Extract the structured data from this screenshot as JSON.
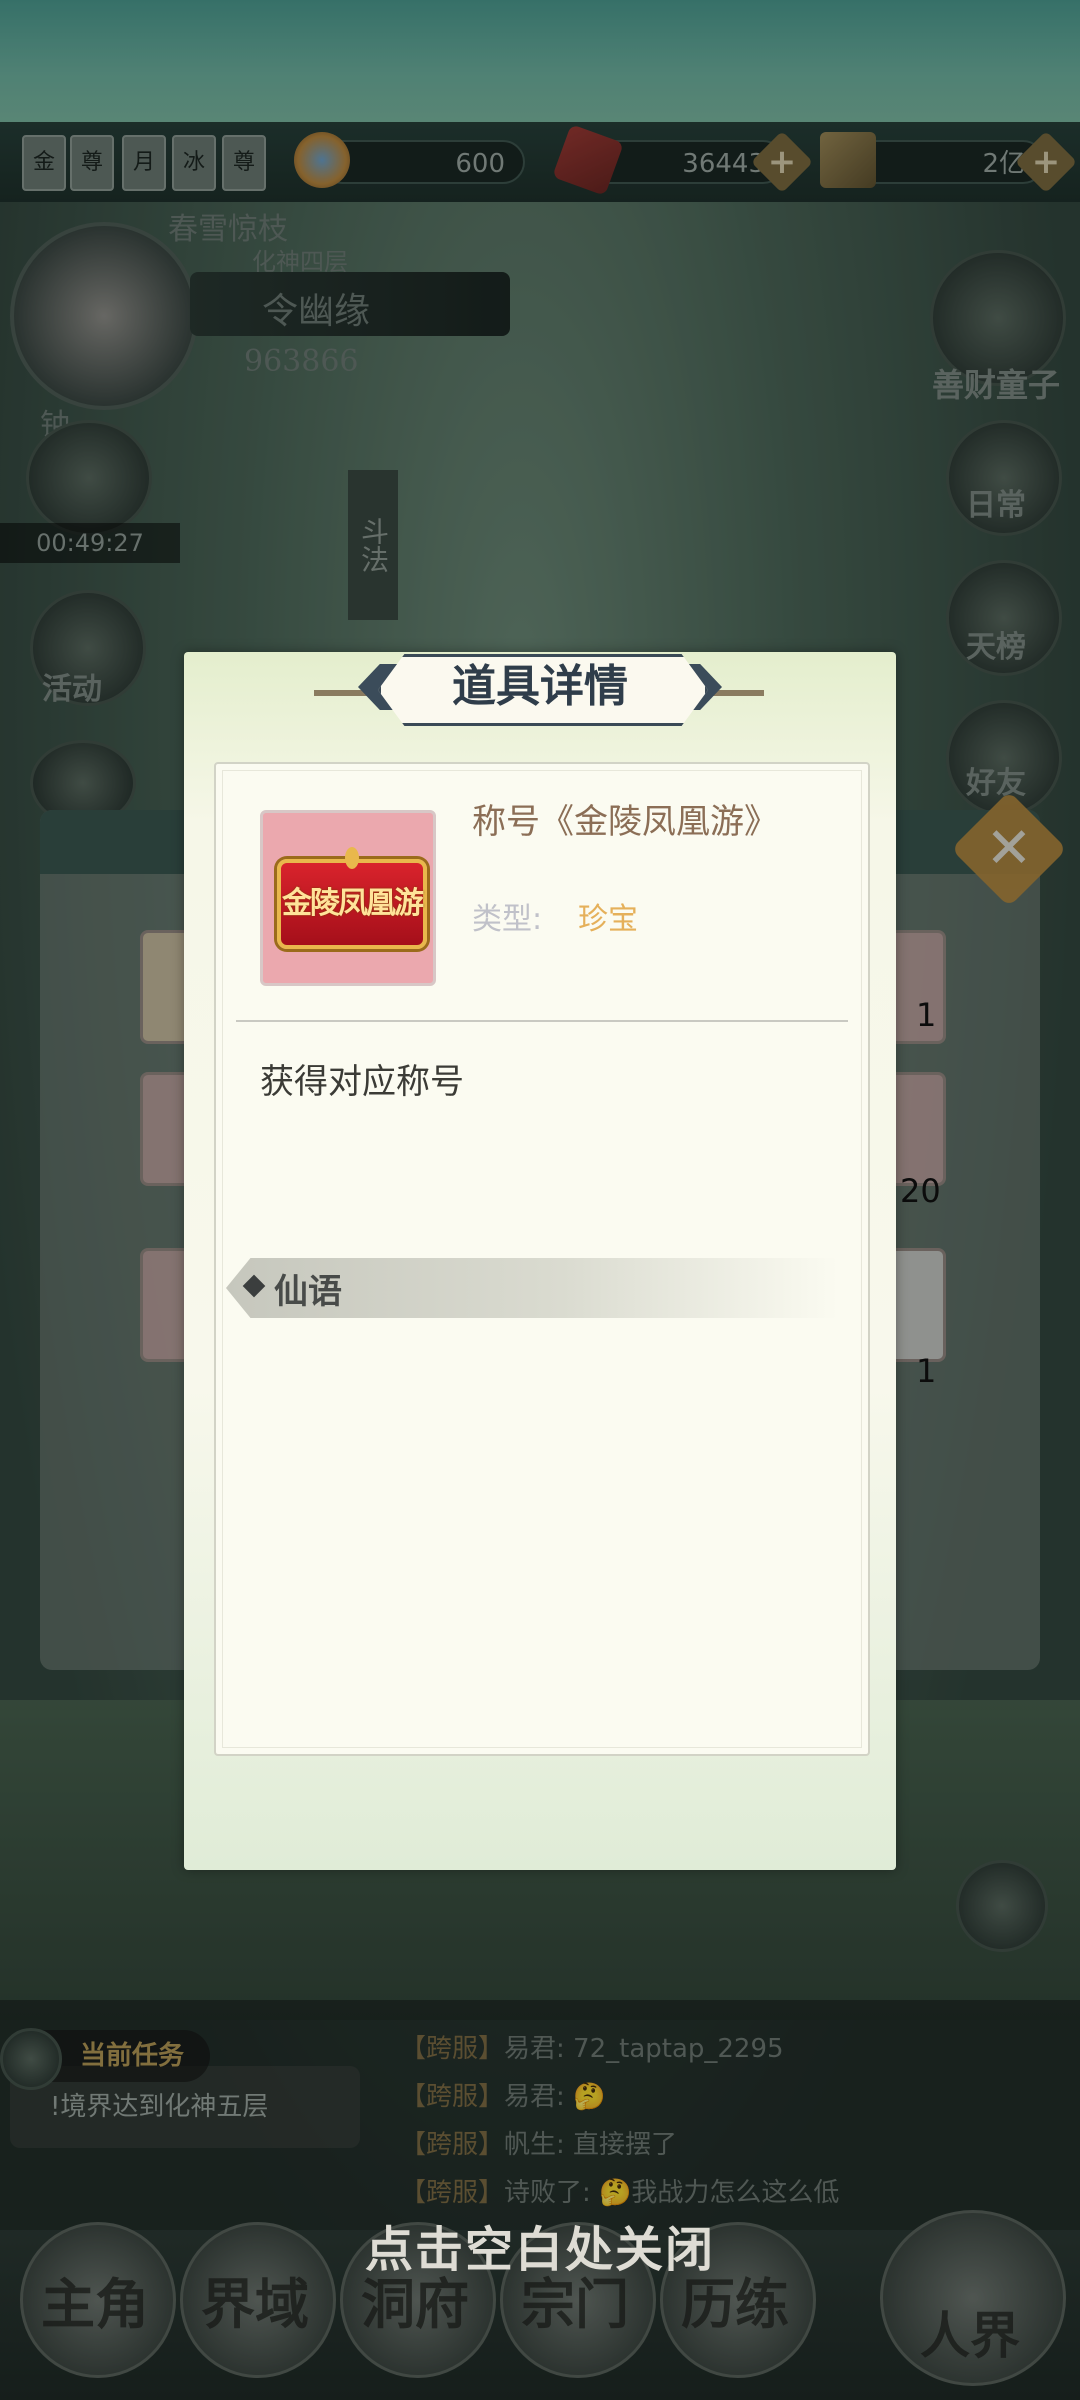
{
  "hud": {
    "badges": [
      "金",
      "尊",
      "月",
      "冰",
      "尊"
    ],
    "jade_amount": "600",
    "gem_amount": "36443",
    "gold_amount": "2亿",
    "player_title_top": "春雪惊枝",
    "realm": "化神四层",
    "player_name": "令幽缘",
    "power": "963866",
    "side_label_top": "钟",
    "timer": "00:49:27",
    "doufa": "斗法",
    "left_activity": "活动",
    "right_buttons": [
      "善财童子",
      "日常",
      "天榜",
      "好友"
    ]
  },
  "inventory": {
    "counts": [
      "1",
      "20",
      "1"
    ]
  },
  "task": {
    "header": "当前任务",
    "body": "!境界达到化神五层"
  },
  "chat": [
    {
      "tag": "【跨服】",
      "name": "易君:",
      "msg": "72_taptap_2295"
    },
    {
      "tag": "【跨服】",
      "name": "易君:",
      "msg": "🤔"
    },
    {
      "tag": "【跨服】",
      "name": "帆生:",
      "msg": "直接摆了"
    },
    {
      "tag": "【跨服】",
      "name": "诗败了:",
      "msg": "🤔我战力怎么这么低"
    }
  ],
  "nav": [
    "主角",
    "界域",
    "洞府",
    "宗门",
    "历练",
    "人界"
  ],
  "close_hint": "点击空白处关闭",
  "modal": {
    "title": "道具详情",
    "item_banner_text": "金陵凤凰游",
    "item_name": "称号《金陵凤凰游》",
    "type_label": "类型:",
    "type_value": "珍宝",
    "description": "获得对应称号",
    "section_title": "仙语"
  }
}
